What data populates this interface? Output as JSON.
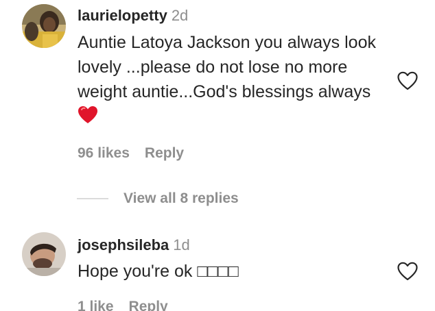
{
  "comments": [
    {
      "username": "laurielopetty",
      "time": "2d",
      "text": "Auntie Latoya Jackson you always look lovely ...please do not lose no more weight auntie...God's blessings always",
      "emoji_icon": "red-heart-icon",
      "likes": "96 likes",
      "reply": "Reply",
      "like_icon": "heart-outline-icon"
    },
    {
      "username": "josephsileba",
      "time": "1d",
      "text": "Hope you're ok □□□□",
      "likes": "1 like",
      "reply": "Reply",
      "like_icon": "heart-outline-icon"
    }
  ],
  "view_replies": "View all 8 replies",
  "colors": {
    "text": "#262626",
    "muted": "#8e8e8e",
    "emoji_heart": "#e0152b",
    "divider": "#dbdbdb"
  }
}
